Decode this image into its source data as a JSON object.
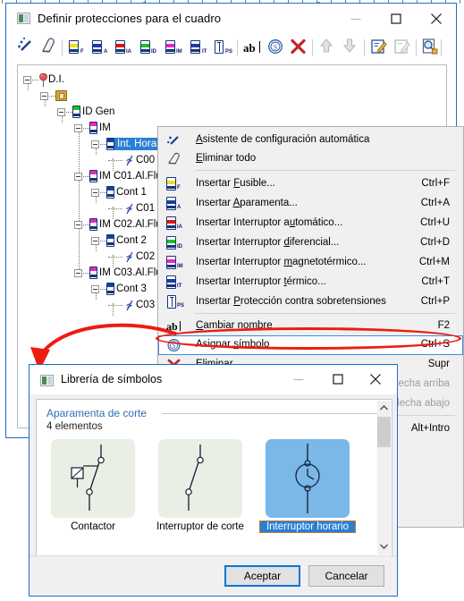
{
  "main_window": {
    "title": "Definir protecciones para el cuadro",
    "icon": "app-window-icon",
    "controls": {
      "minimize": "minimize-icon",
      "maximize": "maximize-icon",
      "close": "close-icon"
    },
    "toolbar": [
      {
        "name": "auto-config-wizard",
        "icon": "magic-wand-icon",
        "label": ""
      },
      {
        "name": "erase-all",
        "icon": "eraser-icon",
        "label": ""
      },
      {
        "name": "insert-fusible",
        "icon": "device-icon",
        "label": "F",
        "color": "#f2e014"
      },
      {
        "name": "insert-aparamenta",
        "icon": "device-icon",
        "label": "A",
        "color": "#1b3fa0"
      },
      {
        "name": "insert-interruptor-automatico",
        "icon": "device-icon",
        "label": "IA",
        "color": "#e81010"
      },
      {
        "name": "insert-interruptor-diferencial",
        "icon": "device-icon",
        "label": "ID",
        "color": "#16c41a"
      },
      {
        "name": "insert-interruptor-magnetotermico",
        "icon": "device-icon",
        "label": "IM",
        "color": "#ef23c0"
      },
      {
        "name": "insert-interruptor-termico",
        "icon": "device-icon",
        "label": "IT",
        "color": "#1b3fa0"
      },
      {
        "name": "insert-proteccion-sobretensiones",
        "icon": "spd-icon",
        "label": "PS",
        "color": "#ffffff"
      },
      {
        "name": "rename",
        "icon": "ab-text-icon",
        "label": "ab"
      },
      {
        "name": "assign-symbol",
        "icon": "circled-s-icon",
        "label": ""
      },
      {
        "name": "delete",
        "icon": "red-x-icon",
        "label": ""
      },
      {
        "name": "move-up",
        "icon": "arrow-up-icon",
        "label": ""
      },
      {
        "name": "move-down",
        "icon": "arrow-down-icon",
        "label": ""
      },
      {
        "name": "edit-properties",
        "icon": "edit-note-icon",
        "label": ""
      },
      {
        "name": "edit-properties-alt",
        "icon": "edit-note-disabled-icon",
        "label": ""
      },
      {
        "name": "preview",
        "icon": "print-preview-icon",
        "label": ""
      },
      {
        "name": "text-report",
        "icon": "txt-balloon-icon",
        "label": ""
      }
    ],
    "tree": [
      {
        "label": "D.I.",
        "depth": 0,
        "icon": "pin-icon",
        "color": "#d84343",
        "selected": false
      },
      {
        "label": "",
        "depth": 1,
        "icon": "folder-icon",
        "color": "#d9a43a",
        "selected": false
      },
      {
        "label": "ID Gen",
        "depth": 2,
        "icon": "device-icon",
        "color": "#16c41a",
        "selected": false
      },
      {
        "label": "IM",
        "depth": 3,
        "icon": "device-icon",
        "color": "#ef23c0",
        "selected": false
      },
      {
        "label": "Int. Horario",
        "depth": 4,
        "icon": "device-icon",
        "color": "#1b3fa0",
        "selected": true
      },
      {
        "label": "C00",
        "depth": 5,
        "icon": "circuit-icon",
        "color": "#1b3fa0",
        "selected": false
      },
      {
        "label": "IM C01.Al.Flu",
        "depth": 3,
        "icon": "device-icon",
        "color": "#ef23c0",
        "selected": false
      },
      {
        "label": "Cont 1",
        "depth": 4,
        "icon": "device-icon",
        "color": "#1b3fa0",
        "selected": false
      },
      {
        "label": "C01 .",
        "depth": 5,
        "icon": "circuit-icon",
        "color": "#1b3fa0",
        "selected": false
      },
      {
        "label": "IM C02.Al.Flu",
        "depth": 3,
        "icon": "device-icon",
        "color": "#ef23c0",
        "selected": false
      },
      {
        "label": "Cont 2",
        "depth": 4,
        "icon": "device-icon",
        "color": "#1b3fa0",
        "selected": false
      },
      {
        "label": "C02 .",
        "depth": 5,
        "icon": "circuit-icon",
        "color": "#1b3fa0",
        "selected": false
      },
      {
        "label": "IM C03.Al.Flu",
        "depth": 3,
        "icon": "device-icon",
        "color": "#ef23c0",
        "selected": false
      },
      {
        "label": "Cont 3",
        "depth": 4,
        "icon": "device-icon",
        "color": "#1b3fa0",
        "selected": false
      },
      {
        "label": "C03 .",
        "depth": 5,
        "icon": "circuit-icon",
        "color": "#1b3fa0",
        "selected": false
      }
    ]
  },
  "context_menu": {
    "items": [
      {
        "label": "Asistente de configuración automática",
        "accel": "",
        "icon": "magic-wand-icon",
        "underline": "A",
        "sep_after": false,
        "disabled": false,
        "highlighted": false
      },
      {
        "label": "Eliminar todo",
        "accel": "",
        "icon": "eraser-icon",
        "underline": "E",
        "sep_after": true,
        "disabled": false,
        "highlighted": false
      },
      {
        "label": "Insertar Fusible...",
        "accel": "Ctrl+F",
        "icon": "device-f-icon",
        "underline": "F",
        "sep_after": false,
        "disabled": false,
        "highlighted": false
      },
      {
        "label": "Insertar Aparamenta...",
        "accel": "Ctrl+A",
        "icon": "device-a-icon",
        "underline": "A",
        "sep_after": false,
        "disabled": false,
        "highlighted": false
      },
      {
        "label": "Insertar Interruptor automático...",
        "accel": "Ctrl+U",
        "icon": "device-ia-icon",
        "underline": "u",
        "sep_after": false,
        "disabled": false,
        "highlighted": false
      },
      {
        "label": "Insertar Interruptor diferencial...",
        "accel": "Ctrl+D",
        "icon": "device-id-icon",
        "underline": "d",
        "sep_after": false,
        "disabled": false,
        "highlighted": false
      },
      {
        "label": "Insertar Interruptor magnetotérmico...",
        "accel": "Ctrl+M",
        "icon": "device-im-icon",
        "underline": "m",
        "sep_after": false,
        "disabled": false,
        "highlighted": false
      },
      {
        "label": "Insertar Interruptor térmico...",
        "accel": "Ctrl+T",
        "icon": "device-it-icon",
        "underline": "t",
        "sep_after": false,
        "disabled": false,
        "highlighted": false
      },
      {
        "label": "Insertar Protección contra sobretensiones",
        "accel": "Ctrl+P",
        "icon": "spd-ps-icon",
        "underline": "P",
        "sep_after": true,
        "disabled": false,
        "highlighted": false
      },
      {
        "label": "Cambiar nombre",
        "accel": "F2",
        "icon": "ab-text-icon",
        "underline": "C",
        "sep_after": false,
        "disabled": false,
        "highlighted": false
      },
      {
        "label": "Asignar símbolo",
        "accel": "Ctrl+S",
        "icon": "circled-s-icon",
        "underline": "s",
        "sep_after": false,
        "disabled": false,
        "highlighted": true
      },
      {
        "label": "Eliminar",
        "accel": "Supr",
        "icon": "red-x-icon",
        "underline": "E",
        "sep_after": false,
        "disabled": false,
        "highlighted": false
      },
      {
        "label": "",
        "accel": "Flecha arriba",
        "icon": "arrow-up-icon",
        "underline": "",
        "sep_after": false,
        "disabled": true,
        "highlighted": false
      },
      {
        "label": "",
        "accel": "Flecha abajo",
        "icon": "arrow-down-icon",
        "underline": "",
        "sep_after": true,
        "disabled": true,
        "highlighted": false
      },
      {
        "label": "",
        "accel": "Alt+Intro",
        "icon": "properties-icon",
        "underline": "",
        "sep_after": false,
        "disabled": false,
        "highlighted": false
      }
    ]
  },
  "annotation": {
    "color": "#ee1b11",
    "shape": "arrow-from-menu-item-to-dialog"
  },
  "library_dialog": {
    "title": "Librería de símbolos",
    "icon": "app-window-icon",
    "controls": {
      "minimize": "minimize-icon",
      "maximize": "maximize-icon",
      "close": "close-icon"
    },
    "group_title": "Aparamenta de corte",
    "group_count": "4 elementos",
    "symbols": [
      {
        "name": "Contactor",
        "icon": "contactor-symbol",
        "selected": false
      },
      {
        "name": "Interruptor de corte",
        "icon": "switch-symbol",
        "selected": false
      },
      {
        "name": "Interruptor horario",
        "icon": "time-switch-symbol",
        "selected": true
      }
    ],
    "scrollbar": {
      "up": "chevron-up-icon",
      "down": "chevron-down-icon"
    },
    "buttons": {
      "accept": "Aceptar",
      "cancel": "Cancelar"
    }
  }
}
